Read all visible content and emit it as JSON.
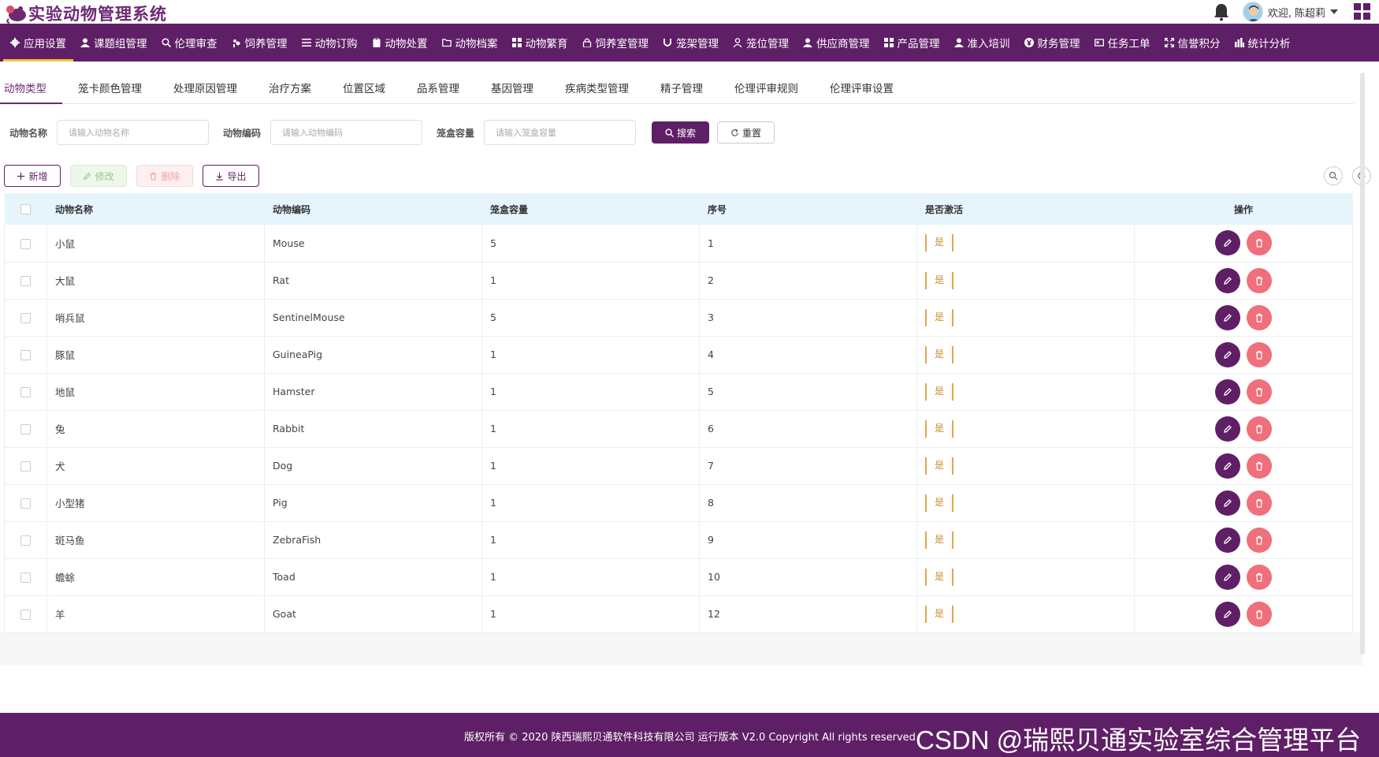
{
  "app": {
    "title": "实验动物管理系统",
    "welcome": "欢迎, 陈超莉"
  },
  "nav": {
    "items": [
      {
        "label": "应用设置",
        "icon": "gear-icon",
        "active": true
      },
      {
        "label": "课题组管理",
        "icon": "user-icon"
      },
      {
        "label": "伦理审查",
        "icon": "search-icon"
      },
      {
        "label": "饲养管理",
        "icon": "feed-icon"
      },
      {
        "label": "动物订购",
        "icon": "list-icon"
      },
      {
        "label": "动物处置",
        "icon": "clipboard-icon"
      },
      {
        "label": "动物档案",
        "icon": "folder-icon"
      },
      {
        "label": "动物繁育",
        "icon": "grid-icon"
      },
      {
        "label": "饲养室管理",
        "icon": "lock-icon"
      },
      {
        "label": "笼架管理",
        "icon": "magnet-icon"
      },
      {
        "label": "笼位管理",
        "icon": "person-outline-icon"
      },
      {
        "label": "供应商管理",
        "icon": "user-icon"
      },
      {
        "label": "产品管理",
        "icon": "grid-icon"
      },
      {
        "label": "准入培训",
        "icon": "user-icon"
      },
      {
        "label": "财务管理",
        "icon": "yen-icon"
      },
      {
        "label": "任务工单",
        "icon": "card-icon"
      },
      {
        "label": "信誉积分",
        "icon": "expand-icon"
      },
      {
        "label": "统计分析",
        "icon": "bar-chart-icon"
      }
    ]
  },
  "tabs": [
    {
      "label": "动物类型",
      "active": true
    },
    {
      "label": "笼卡颜色管理"
    },
    {
      "label": "处理原因管理"
    },
    {
      "label": "治疗方案"
    },
    {
      "label": "位置区域"
    },
    {
      "label": "品系管理"
    },
    {
      "label": "基因管理"
    },
    {
      "label": "疾病类型管理"
    },
    {
      "label": "精子管理"
    },
    {
      "label": "伦理评审规则"
    },
    {
      "label": "伦理评审设置"
    }
  ],
  "search": {
    "name_label": "动物名称",
    "name_placeholder": "请输入动物名称",
    "code_label": "动物编码",
    "code_placeholder": "请输入动物编码",
    "capacity_label": "笼盒容量",
    "capacity_placeholder": "请输入笼盒容量",
    "search_button": "搜索",
    "reset_button": "重置"
  },
  "toolbar": {
    "add": "新增",
    "edit": "修改",
    "delete": "删除",
    "export": "导出"
  },
  "table": {
    "headers": [
      "动物名称",
      "动物编码",
      "笼盒容量",
      "序号",
      "是否激活",
      "操作"
    ],
    "rows": [
      {
        "name": "小鼠",
        "code": "Mouse",
        "capacity": "5",
        "seq": "1",
        "active": "是"
      },
      {
        "name": "大鼠",
        "code": "Rat",
        "capacity": "1",
        "seq": "2",
        "active": "是"
      },
      {
        "name": "哨兵鼠",
        "code": "SentinelMouse",
        "capacity": "5",
        "seq": "3",
        "active": "是"
      },
      {
        "name": "豚鼠",
        "code": "GuineaPig",
        "capacity": "1",
        "seq": "4",
        "active": "是"
      },
      {
        "name": "地鼠",
        "code": "Hamster",
        "capacity": "1",
        "seq": "5",
        "active": "是"
      },
      {
        "name": "兔",
        "code": "Rabbit",
        "capacity": "1",
        "seq": "6",
        "active": "是"
      },
      {
        "name": "犬",
        "code": "Dog",
        "capacity": "1",
        "seq": "7",
        "active": "是"
      },
      {
        "name": "小型猪",
        "code": "Pig",
        "capacity": "1",
        "seq": "8",
        "active": "是"
      },
      {
        "name": "斑马鱼",
        "code": "ZebraFish",
        "capacity": "1",
        "seq": "9",
        "active": "是"
      },
      {
        "name": "蟾蜍",
        "code": "Toad",
        "capacity": "1",
        "seq": "10",
        "active": "是"
      },
      {
        "name": "羊",
        "code": "Goat",
        "capacity": "1",
        "seq": "12",
        "active": "是"
      }
    ]
  },
  "footer": {
    "copyright": "版权所有 © 2020 陕西瑞熙贝通软件科技有限公司 运行版本 V2.0 Copyright All rights reserved",
    "watermark": "CSDN @瑞熙贝通实验室综合管理平台"
  },
  "colors": {
    "brand": "#5f1f66",
    "accent": "#f3c343",
    "active_tag": "#c8902e",
    "delete": "#ef6f7a"
  }
}
